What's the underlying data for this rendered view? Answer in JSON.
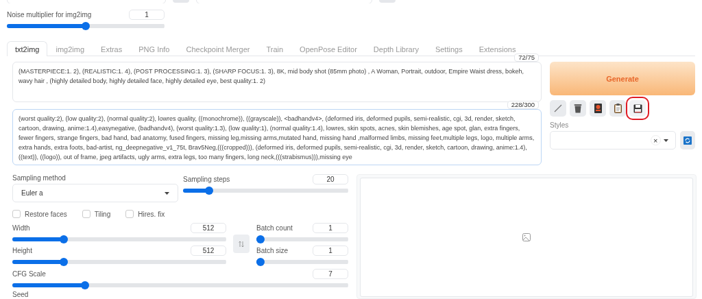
{
  "noise": {
    "label": "Noise multiplier for img2img",
    "value": "1",
    "level": 0.5
  },
  "tabs": [
    {
      "label": "txt2img",
      "selected": true
    },
    {
      "label": "img2img",
      "selected": false
    },
    {
      "label": "Extras",
      "selected": false
    },
    {
      "label": "PNG Info",
      "selected": false
    },
    {
      "label": "Checkpoint Merger",
      "selected": false
    },
    {
      "label": "Train",
      "selected": false
    },
    {
      "label": "OpenPose Editor",
      "selected": false
    },
    {
      "label": "Depth Library",
      "selected": false
    },
    {
      "label": "Settings",
      "selected": false
    },
    {
      "label": "Extensions",
      "selected": false
    }
  ],
  "prompt": {
    "counter": "72/75",
    "text": "(MASTERPIECE:1. 2), (REALISTIC:1. 4), (POST PROCESSING:1. 3), (SHARP FOCUS:1. 3), 8K, mid body shot (85mm photo) , A Woman, Portrait, outdoor, Empire Waist dress, bokeh, wavy hair , (highly detailed body, highly detailed face, highly detailed eye, best quality:1. 2)"
  },
  "negative_prompt": {
    "counter": "228/300",
    "text": "(worst quality:2), (low quality:2), (normal quality:2), lowres quality, ((monochrome)), ((grayscale)), <badhandv4>, (deformed iris, deformed pupils, semi-realistic, cgi, 3d, render, sketch, cartoon, drawing, anime:1.4),easynegative, (badhandv4), (worst quality:1.3), (low quality:1), (normal quality:1.4), lowres, skin spots, acnes, skin blemishes, age spot, glan, extra fingers, fewer fingers, strange fingers, bad hand, bad anatomy, fused fingers, missing leg,missing arms,mutated hand, missing hand ,malformed limbs, missing feet,multiple legs, logo, multiple arms, extra hands, extra foots, bad-artist, ng_deepnegative_v1_75t, Brav5Neg,(((cropped))), (deformed iris, deformed pupils, semi-realistic, cgi, 3d, render, sketch, cartoon, drawing, anime:1.4), ((text)), ((logo)), out of frame, jpeg artifacts, ugly arms, extra legs, too many fingers, long neck,(((strabismus))),missing eye"
  },
  "generate_button": "Generate",
  "tools": [
    {
      "kind": "pencil",
      "highlighted": false
    },
    {
      "kind": "trash",
      "highlighted": false
    },
    {
      "kind": "card",
      "highlighted": false
    },
    {
      "kind": "clipboard",
      "highlighted": false
    },
    {
      "kind": "save",
      "highlighted": true
    }
  ],
  "styles": {
    "label": "Styles",
    "clear": "×"
  },
  "sampling_method": {
    "label": "Sampling method",
    "value": "Euler a"
  },
  "sampling_steps": {
    "label": "Sampling steps",
    "value": "20",
    "level": 0.14
  },
  "checkboxes": [
    {
      "label": "Restore faces",
      "checked": false
    },
    {
      "label": "Tiling",
      "checked": false
    },
    {
      "label": "Hires. fix",
      "checked": false
    }
  ],
  "width": {
    "label": "Width",
    "value": "512",
    "level": 0.23
  },
  "height": {
    "label": "Height",
    "value": "512",
    "level": 0.23
  },
  "batch_count": {
    "label": "Batch count",
    "value": "1",
    "level": 0
  },
  "batch_size": {
    "label": "Batch size",
    "value": "1",
    "level": 0
  },
  "cfg_scale": {
    "label": "CFG Scale",
    "value": "7",
    "level": 0.21
  },
  "seed": {
    "label": "Seed"
  }
}
